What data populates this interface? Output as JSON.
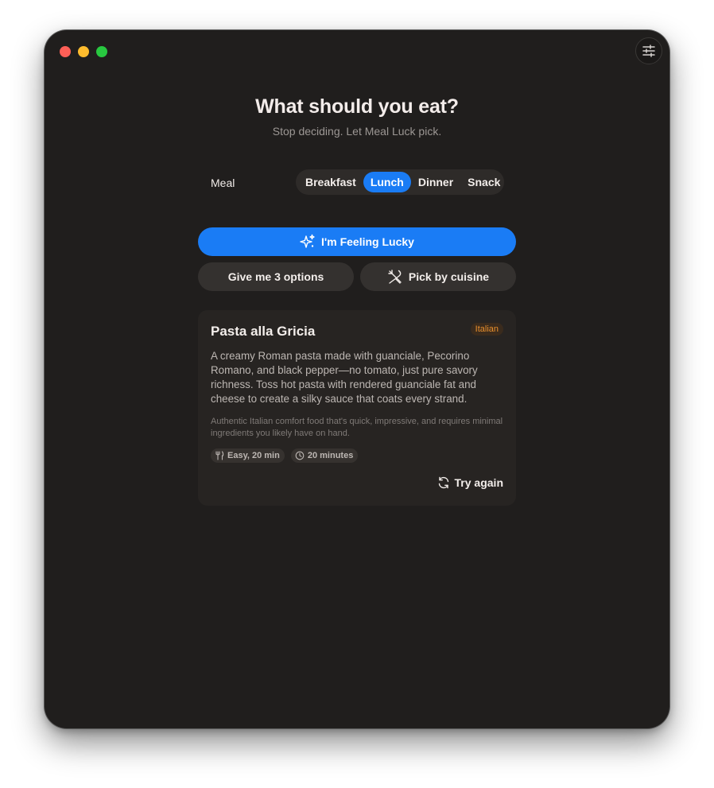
{
  "window": {
    "traffic_lights": [
      "close",
      "minimize",
      "zoom"
    ]
  },
  "header": {
    "title": "What should you eat?",
    "subtitle": "Stop deciding. Let Meal Luck pick."
  },
  "meal": {
    "label": "Meal",
    "options": [
      "Breakfast",
      "Lunch",
      "Dinner",
      "Snack"
    ],
    "selected": "Lunch"
  },
  "actions": {
    "lucky_label": "I'm Feeling Lucky",
    "options_label": "Give me 3 options",
    "cuisine_label": "Pick by cuisine"
  },
  "result": {
    "title": "Pasta alla Gricia",
    "cuisine": "Italian",
    "description": "A creamy Roman pasta made with guanciale, Pecorino Romano, and black pepper—no tomato, just pure savory richness. Toss hot pasta with rendered guanciale fat and cheese to create a silky sauce that coats every strand.",
    "note": "Authentic Italian comfort food that's quick, impressive, and requires minimal ingredients you likely have on hand.",
    "difficulty": "Easy, 20 min",
    "time": "20 minutes",
    "try_again_label": "Try again"
  },
  "colors": {
    "accent": "#1a7cf5",
    "background": "#201e1d",
    "card": "#272422",
    "cuisine_badge_text": "#e98f2d"
  },
  "icons": {
    "settings": "sliders-icon",
    "lucky": "sparkles-icon",
    "cuisine": "utensils-crossed-icon",
    "difficulty": "fork-knife-icon",
    "time": "clock-icon",
    "retry": "refresh-icon"
  }
}
